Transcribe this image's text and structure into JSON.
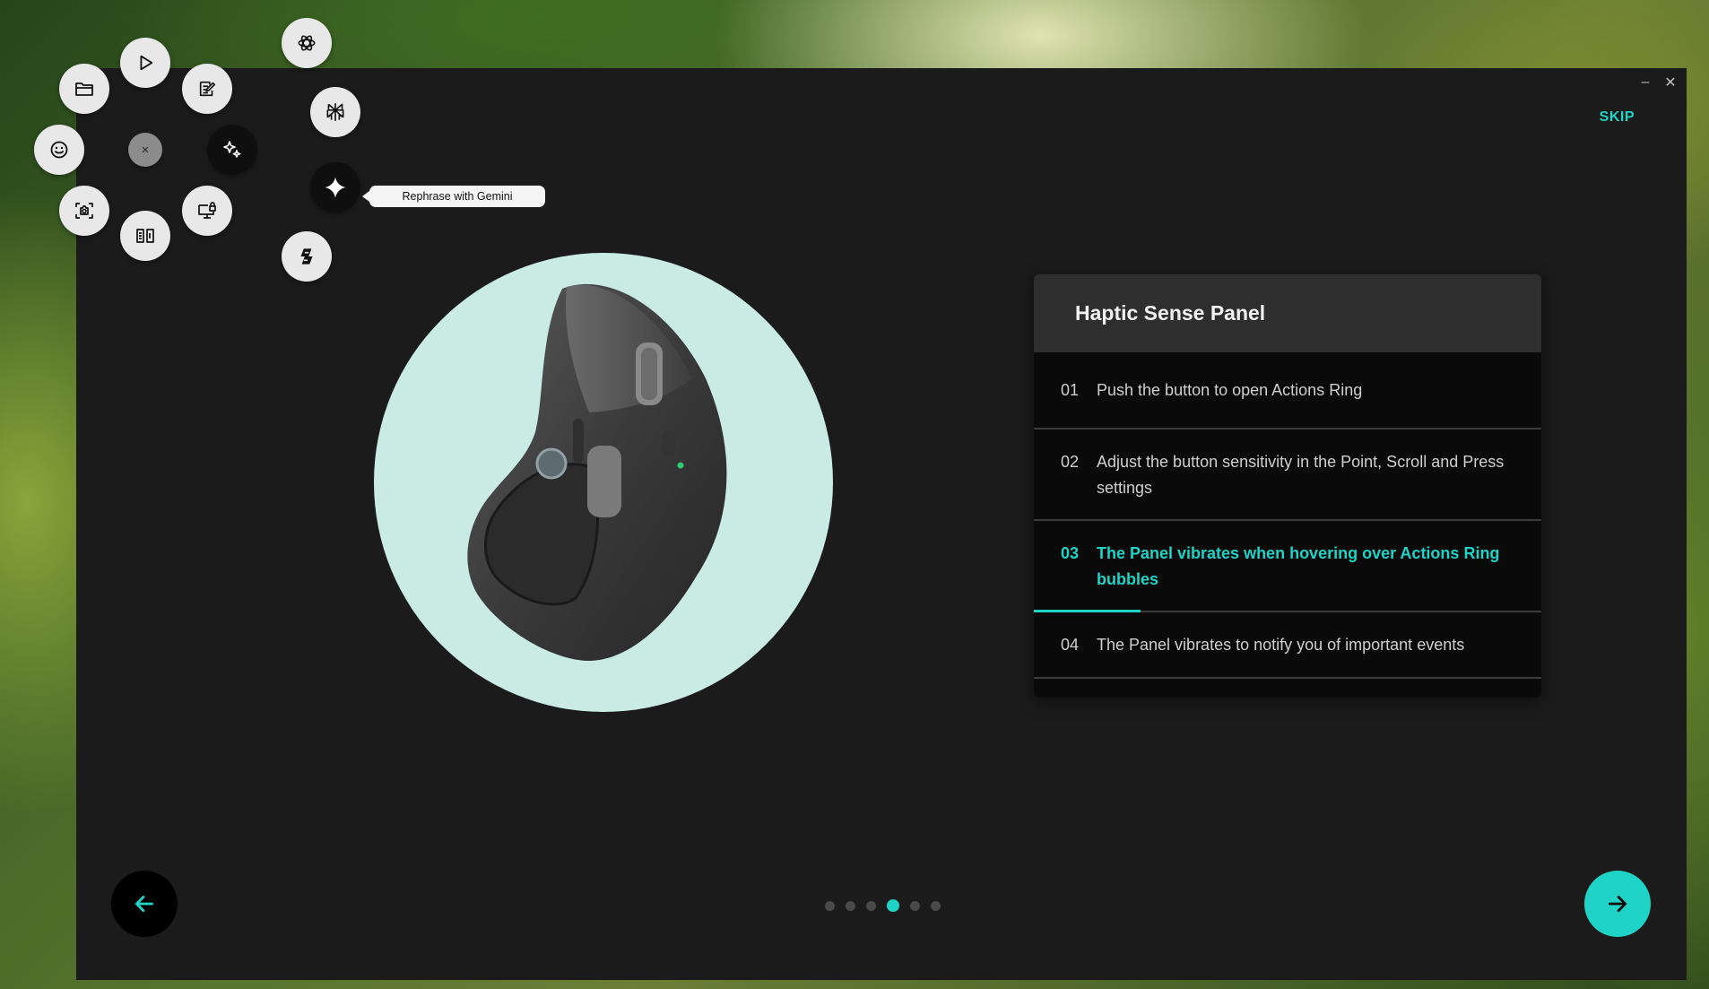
{
  "window": {
    "minimize_label": "–",
    "close_label": "✕",
    "skip_label": "SKIP"
  },
  "panel": {
    "title": "Haptic Sense Panel",
    "steps": [
      {
        "num": "01",
        "text": "Push the button to open Actions Ring"
      },
      {
        "num": "02",
        "text": "Adjust the button sensitivity in the Point, Scroll and Press settings"
      },
      {
        "num": "03",
        "text": "The Panel vibrates when hovering over Actions Ring bubbles",
        "active": true,
        "progress_fraction": 0.21
      },
      {
        "num": "04",
        "text": "The Panel vibrates to notify you of important events"
      }
    ]
  },
  "pagination": {
    "total": 6,
    "active_index": 3
  },
  "navigation": {
    "back_icon": "arrow-left-icon",
    "next_icon": "arrow-right-icon"
  },
  "actions_ring": {
    "center_close_label": "×",
    "items": [
      {
        "name": "play",
        "icon": "play-icon"
      },
      {
        "name": "edit-note",
        "icon": "edit-note-icon"
      },
      {
        "name": "ai-sparkles",
        "icon": "ai-sparkles-icon"
      },
      {
        "name": "screen-lock",
        "icon": "monitor-lock-icon"
      },
      {
        "name": "split-view",
        "icon": "split-view-icon"
      },
      {
        "name": "screenshot",
        "icon": "screenshot-icon"
      },
      {
        "name": "emoji",
        "icon": "emoji-icon"
      },
      {
        "name": "folder",
        "icon": "folder-icon"
      }
    ],
    "ai_submenu": [
      {
        "name": "chatgpt",
        "icon": "chatgpt-icon"
      },
      {
        "name": "perplexity",
        "icon": "perplexity-icon"
      },
      {
        "name": "gemini",
        "icon": "gemini-icon",
        "tooltip": "Rephrase with Gemini"
      },
      {
        "name": "copilot",
        "icon": "copilot-icon"
      }
    ]
  },
  "colors": {
    "accent": "#1fd3c6",
    "window_bg": "#1b1b1b",
    "panel_bg": "#0a0a0a",
    "panel_header_bg": "#2e2e2e",
    "product_circle": "#c9ebe4"
  }
}
